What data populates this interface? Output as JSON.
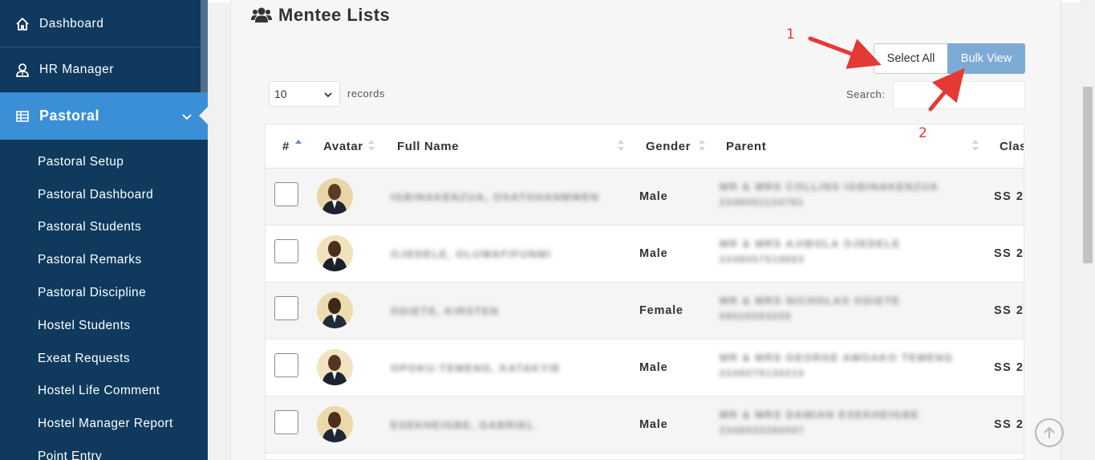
{
  "sidebar": {
    "items": [
      {
        "label": "Dashboard",
        "icon": "home-icon"
      },
      {
        "label": "HR Manager",
        "icon": "user-tie-icon"
      },
      {
        "label": "Pastoral",
        "icon": "table-icon"
      }
    ],
    "submenu": [
      "Pastoral Setup",
      "Pastoral Dashboard",
      "Pastoral Students",
      "Pastoral Remarks",
      "Pastoral Discipline",
      "Hostel Students",
      "Exeat Requests",
      "Hostel Life Comment",
      "Hostel Manager Report",
      "Point Entry"
    ]
  },
  "main": {
    "title": "Mentee Lists",
    "select_all_label": "Select All",
    "bulk_view_label": "Bulk View",
    "page_length": "10",
    "records_label": "records",
    "search_label": "Search:",
    "annotation_1": "1",
    "annotation_2": "2"
  },
  "table": {
    "columns": [
      "#",
      "Avatar",
      "Full Name",
      "Gender",
      "Parent",
      "Clas"
    ],
    "rows": [
      {
        "name": "IGBINAKENZUA, OSATOHANMWEN",
        "gender": "Male",
        "parent": "MR & MRS COLLINS IGBINAKENZUA",
        "phone": "2348051124781",
        "class": "SS 2"
      },
      {
        "name": "OJEDELE, OLUWAFIFUNMI",
        "gender": "Male",
        "parent": "MR & MRS AJIBOLA OJEDELE",
        "phone": "2348057519683",
        "class": "SS 2"
      },
      {
        "name": "ODIETE, KIRSTEN",
        "gender": "Female",
        "parent": "MR & MRS NICHOLAS ODIETE",
        "phone": "08025593255",
        "class": "SS 2"
      },
      {
        "name": "OPOKU-TEMENG, KATAKYIE",
        "gender": "Male",
        "parent": "MR & MRS GEORGE AMOAKO TEMENG",
        "phone": "2348079130210",
        "class": "SS 2"
      },
      {
        "name": "ESEKHEIGBE, GABRIEL",
        "gender": "Male",
        "parent": "MR & MRS DAMIAN ESEKHEIGBE",
        "phone": "2348033280097",
        "class": "SS 2"
      }
    ]
  },
  "colors": {
    "sidebar_bg": "#0f3a5e",
    "sidebar_active": "#3a8fd6",
    "bulk_button": "#7eaad6",
    "annotation": "#e53935"
  }
}
